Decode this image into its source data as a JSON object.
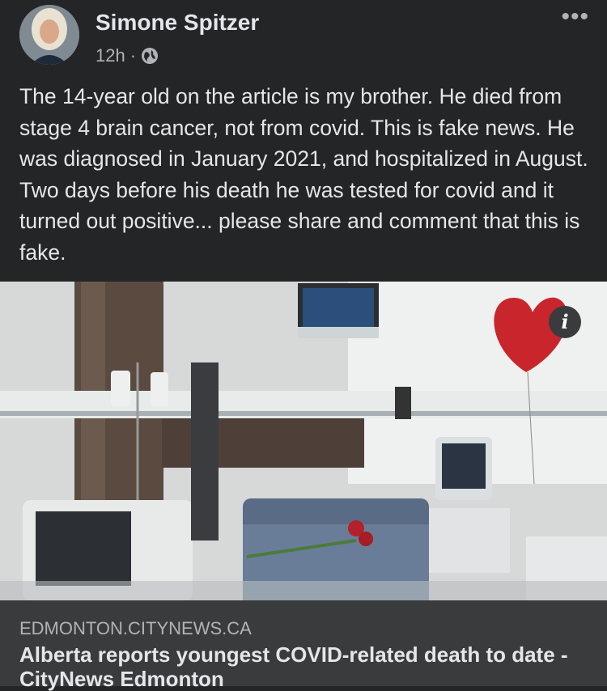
{
  "post": {
    "author": "Simone Spitzer",
    "time": "12h",
    "separator": "·",
    "audience_icon": "globe-icon",
    "more_label": "•••",
    "text": "The 14-year old on the article is my brother. He died from stage 4 brain cancer, not from covid. This is fake news. He was diagnosed in January 2021, and hospitalized in August. Two days before his death he was tested for covid and it turned out positive... please share and comment that this is fake."
  },
  "photo": {
    "info_label": "i"
  },
  "link": {
    "domain": "EDMONTON.CITYNEWS.CA",
    "title": "Alberta reports youngest COVID-related death to date - CityNews Edmonton"
  },
  "colors": {
    "background": "#242526",
    "card": "#3a3b3c",
    "text_primary": "#e4e6eb",
    "text_secondary": "#b0b3b8"
  }
}
